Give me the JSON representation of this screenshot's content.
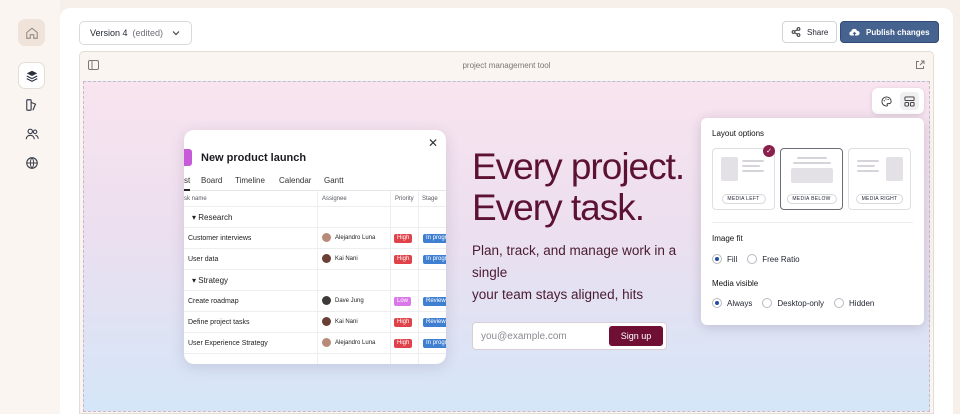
{
  "rail": {
    "items": [
      "home-icon",
      "layers-icon",
      "design-icon",
      "users-icon",
      "globe-icon"
    ],
    "active": "layers-icon"
  },
  "toolbar": {
    "version_label": "Version 4",
    "version_status": "(edited)",
    "share_label": "Share",
    "publish_label": "Publish changes"
  },
  "preview": {
    "title": "project management tool"
  },
  "media_card": {
    "title": "New product launch",
    "tabs": [
      "st",
      "Board",
      "Timeline",
      "Calendar",
      "Gantt"
    ],
    "columns": [
      "sk name",
      "Assignee",
      "Priority",
      "Stage"
    ],
    "groups": [
      {
        "name": "Research",
        "rows": [
          {
            "task": "Customer interviews",
            "assignee": "Alejandro Luna",
            "priority": "High",
            "stage": "In progress"
          },
          {
            "task": "User data",
            "assignee": "Kai Nani",
            "priority": "High",
            "stage": "In progress"
          }
        ]
      },
      {
        "name": "Strategy",
        "rows": [
          {
            "task": "Create roadmap",
            "assignee": "Dave Jung",
            "priority": "Low",
            "stage": "Review"
          },
          {
            "task": "Define project tasks",
            "assignee": "Kai Nani",
            "priority": "High",
            "stage": "Review"
          },
          {
            "task": "User Experience Strategy",
            "assignee": "Alejandro Luna",
            "priority": "High",
            "stage": "In progress"
          }
        ]
      }
    ]
  },
  "hero": {
    "title": "Every project.\nEvery task.",
    "subtitle": "Plan, track, and manage work in a single\nyour team stays aligned, hits deadlines\npainful status meetings.",
    "email_placeholder": "you@example.com",
    "signup_label": "Sign up"
  },
  "panel": {
    "layout_heading": "Layout options",
    "layout_options": [
      {
        "label": "MEDIA LEFT",
        "selected": false
      },
      {
        "label": "MEDIA BELOW",
        "selected": true
      },
      {
        "label": "MEDIA RIGHT",
        "selected": false
      }
    ],
    "image_fit_heading": "Image fit",
    "image_fit_options": [
      "Fill",
      "Free Ratio"
    ],
    "image_fit_selected": "Fill",
    "media_visible_heading": "Media visible",
    "media_visible_options": [
      "Always",
      "Desktop-only",
      "Hidden"
    ],
    "media_visible_selected": "Always"
  },
  "colors": {
    "brand": "#6e0f33",
    "publish": "#46638f",
    "high": "#e0424a",
    "low": "#d978e8",
    "stage": "#3f7fd1"
  }
}
